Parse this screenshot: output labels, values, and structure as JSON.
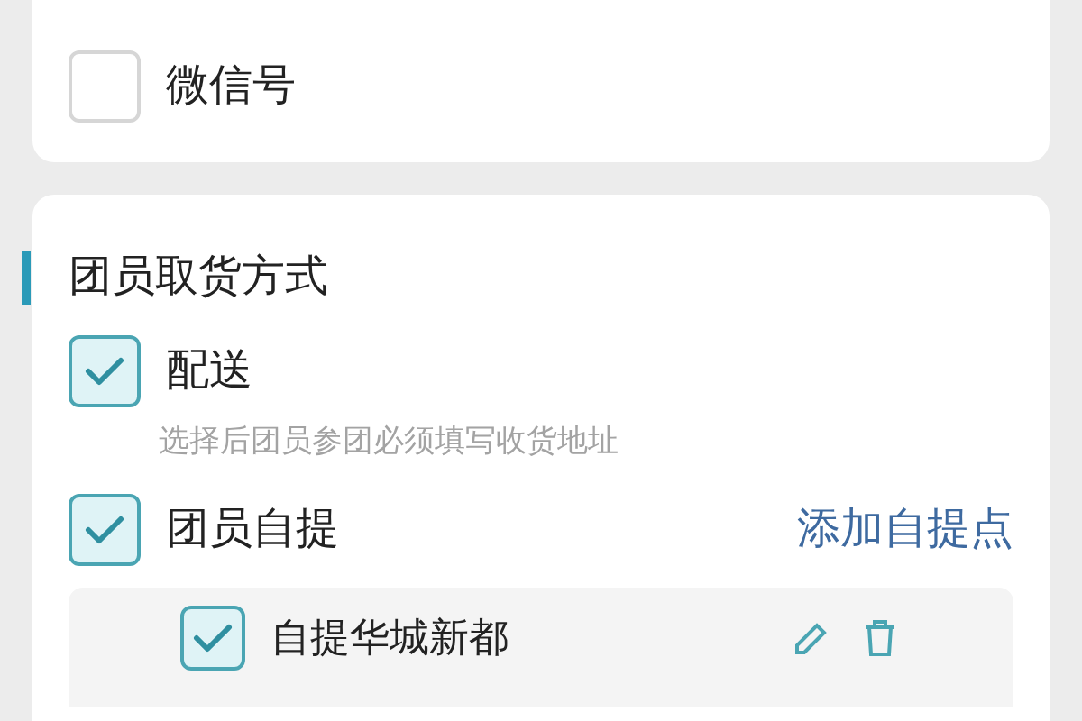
{
  "contact_card": {
    "options": [
      {
        "label": "微信号",
        "checked": false
      }
    ]
  },
  "pickup_section": {
    "title": "团员取货方式",
    "options": [
      {
        "label": "配送",
        "checked": true,
        "hint": "选择后团员参团必须填写收货地址"
      },
      {
        "label": "团员自提",
        "checked": true,
        "action": "添加自提点"
      }
    ],
    "pickup_points": [
      {
        "name": "自提华城新都",
        "checked": true
      }
    ]
  }
}
